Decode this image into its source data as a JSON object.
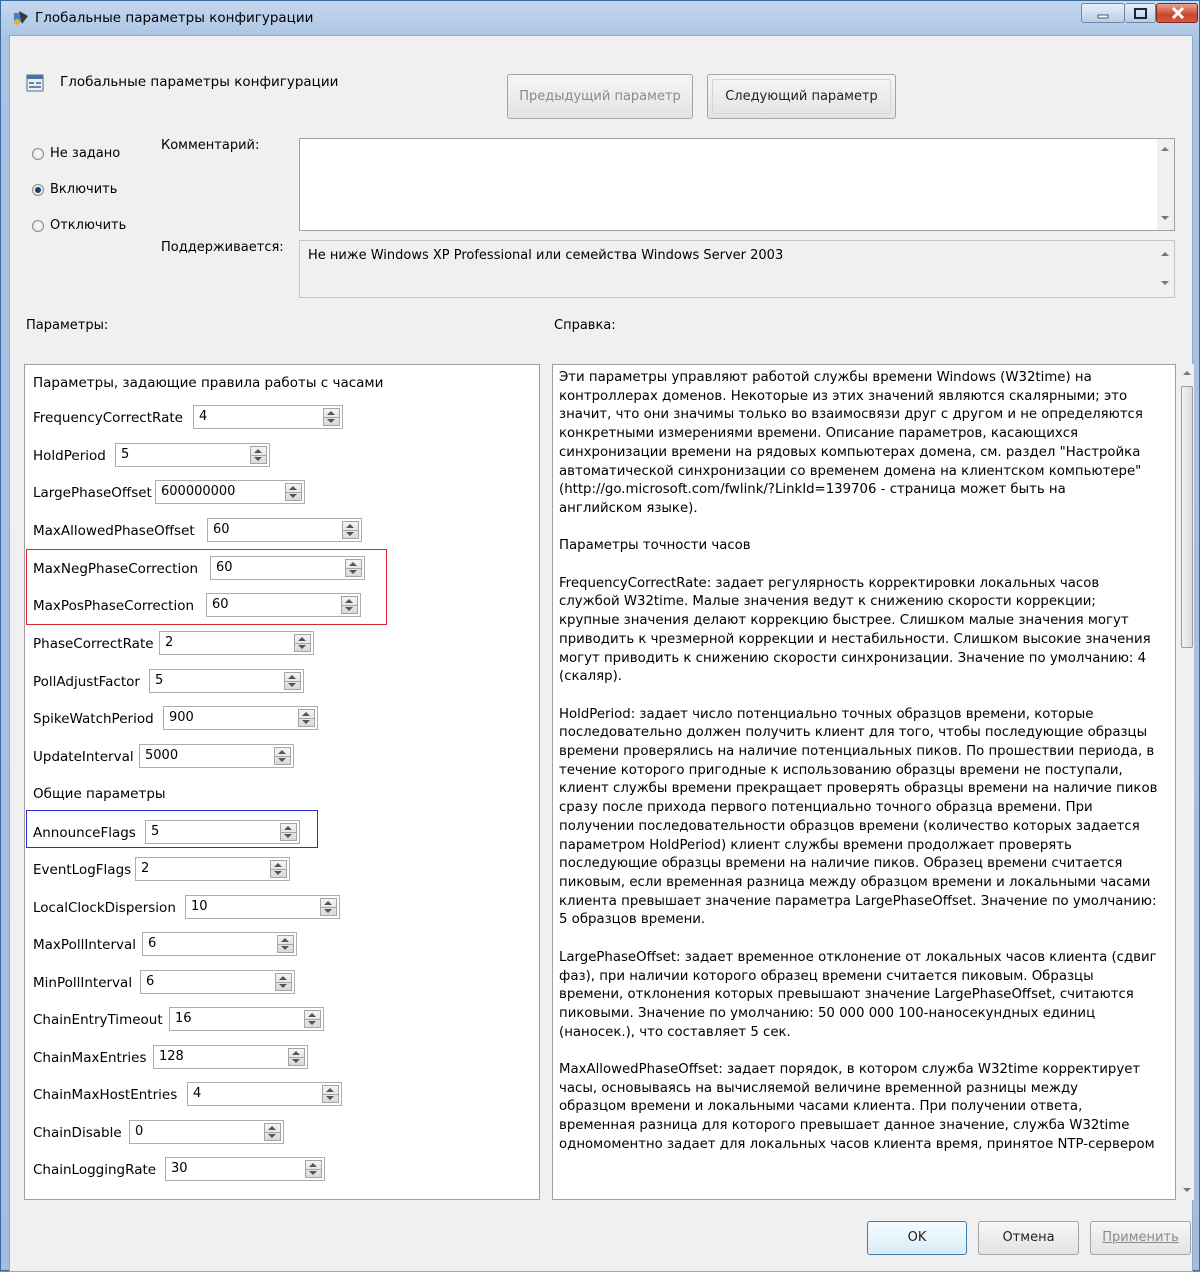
{
  "window": {
    "title": "Глобальные параметры конфигурации"
  },
  "header": {
    "policy_name": "Глобальные параметры конфигурации",
    "prev_button": "Предыдущий параметр",
    "next_button": "Следующий параметр"
  },
  "state": {
    "not_configured": "Не задано",
    "enabled": "Включить",
    "disabled": "Отключить",
    "selected": "enabled"
  },
  "comment": {
    "label": "Комментарий:",
    "value": ""
  },
  "supported": {
    "label": "Поддерживается:",
    "value": "Не ниже Windows XP Professional или семейства Windows Server 2003"
  },
  "options": {
    "label": "Параметры:",
    "section1": "Параметры, задающие правила работы с часами",
    "section2": "Общие параметры",
    "items": [
      {
        "name": "FrequencyCorrectRate",
        "value": "4"
      },
      {
        "name": "HoldPeriod",
        "value": "5"
      },
      {
        "name": "LargePhaseOffset",
        "value": "600000000"
      },
      {
        "name": "MaxAllowedPhaseOffset",
        "value": "60"
      },
      {
        "name": "MaxNegPhaseCorrection",
        "value": "60"
      },
      {
        "name": "MaxPosPhaseCorrection",
        "value": "60"
      },
      {
        "name": "PhaseCorrectRate",
        "value": "2"
      },
      {
        "name": "PollAdjustFactor",
        "value": "5"
      },
      {
        "name": "SpikeWatchPeriod",
        "value": "900"
      },
      {
        "name": "UpdateInterval",
        "value": "5000"
      },
      {
        "name": "AnnounceFlags",
        "value": "5"
      },
      {
        "name": "EventLogFlags",
        "value": "2"
      },
      {
        "name": "LocalClockDispersion",
        "value": "10"
      },
      {
        "name": "MaxPollInterval",
        "value": "6"
      },
      {
        "name": "MinPollInterval",
        "value": "6"
      },
      {
        "name": "ChainEntryTimeout",
        "value": "16"
      },
      {
        "name": "ChainMaxEntries",
        "value": "128"
      },
      {
        "name": "ChainMaxHostEntries",
        "value": "4"
      },
      {
        "name": "ChainDisable",
        "value": "0"
      },
      {
        "name": "ChainLoggingRate",
        "value": "30"
      }
    ]
  },
  "help": {
    "label": "Справка:",
    "text": "Эти параметры управляют работой службы времени Windows (W32time) на\nконтроллерах доменов. Некоторые из этих значений являются скалярными; это\nзначит, что они значимы только во взаимосвязи друг с другом и не определяются\nконкретными измерениями времени. Описание параметров, касающихся\nсинхронизации времени на рядовых компьютерах домена, см. раздел \"Настройка\nавтоматической синхронизации со временем домена на клиентском компьютере\"\n(http://go.microsoft.com/fwlink/?LinkId=139706 - страница может быть на\nанглийском языке).\n\nПараметры точности часов\n\nFrequencyCorrectRate: задает регулярность корректировки локальных часов\nслужбой W32time. Малые значения ведут к снижению скорости коррекции;\nкрупные значения делают коррекцию быстрее. Слишком малые значения могут\nприводить к чрезмерной коррекции и нестабильности. Слишком высокие значения\nмогут приводить к снижению скорости синхронизации. Значение по умолчанию: 4\n(скаляр).\n\nHoldPeriod: задает число потенциально точных образцов времени, которые\nпоследовательно должен получить клиент для того, чтобы последующие образцы\nвремени проверялись на наличие потенциальных пиков. По прошествии периода, в\nтечение которого пригодные к использованию образцы времени не поступали,\nклиент службы времени прекращает проверять образцы времени на наличие пиков\nсразу после прихода первого потенциально точного образца времени. При\nполучении последовательности образцов времени (количество которых задается\nпараметром HoldPeriod) клиент службы времени продолжает проверять\nпоследующие образцы времени на наличие пиков. Образец времени считается\nпиковым, если временная разница между образцом времени и локальными часами\nклиента превышает значение параметра LargePhaseOffset. Значение по умолчанию:\n5 образцов времени.\n\nLargePhaseOffset: задает временное отклонение от локальных часов клиента (сдвиг\nфаз), при наличии которого образец времени считается пиковым. Образцы\nвремени, отклонения которых превышают значение LargePhaseOffset, считаются\nпиковыми. Значение по умолчанию: 50 000 000 100-наносекундных единиц\n(наносек.), что составляет 5 сек.\n\nMaxAllowedPhaseOffset: задает порядок, в котором служба W32time корректирует\nчасы, основываясь на вычисляемой величине временной разницы между\nобразцом времени и локальными часами клиента. При получении ответа,\nвременная разница для которого превышает данное значение, служба W32time\nодномоментно задает для локальных часов клиента время, принятое NTP-сервером"
  },
  "footer": {
    "ok": "OK",
    "cancel": "Отмена",
    "apply": "Применить"
  }
}
